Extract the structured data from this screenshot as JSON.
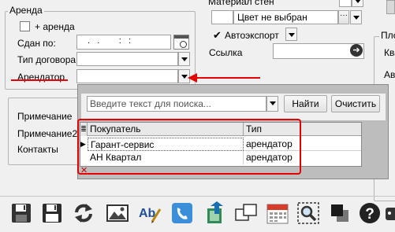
{
  "top_area": {
    "material_label": "Материал стен",
    "color_value": "Цвет не выбран",
    "autoexport_label": "Автоэкспорт",
    "link_label": "Ссылка",
    "right_partial_1": "Пло",
    "right_partial_2": "Ква",
    "right_partial_3": "Авт"
  },
  "rent_group": {
    "title": "Аренда",
    "rent_checkbox_label": "+ аренда",
    "rented_until_label": "Сдан по:",
    "rented_until_value": " .   .        :   :",
    "contract_type_label": "Тип договора",
    "tenant_label": "Арендатор"
  },
  "notes_group": {
    "note_label": "Примечание",
    "note2_label": "Примечание2",
    "contacts_label": "Контакты"
  },
  "lookup_popup": {
    "search_placeholder": "Введите текст для поиска...",
    "find_button": "Найти",
    "clear_button": "Очистить",
    "columns": [
      "Покупатель",
      "Тип"
    ],
    "rows": [
      {
        "buyer": "Гарант-сервис",
        "type": "арендатор"
      },
      {
        "buyer": "АН Квартал",
        "type": "арендатор"
      }
    ]
  },
  "annotation_color": "#e60000",
  "toolbar_icons": [
    "save-new-icon",
    "save-icon",
    "refresh-icon",
    "image-icon",
    "spellcheck-icon",
    "phone-icon",
    "export-icon",
    "copy-windows-icon",
    "calendar-icon",
    "zoom-icon",
    "layers-icon",
    "help-icon",
    "robot-icon"
  ]
}
